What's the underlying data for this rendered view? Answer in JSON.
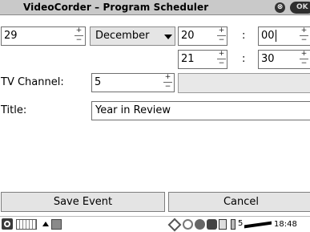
{
  "window": {
    "title": "VideoCorder – Program Scheduler",
    "close_glyph": "⊗",
    "ok_label": "OK"
  },
  "date": {
    "day": "29",
    "month": "December"
  },
  "start_time": {
    "hour": "20",
    "minute": "00"
  },
  "end_time": {
    "hour": "21",
    "minute": "30"
  },
  "time_separator": ":",
  "spinner": {
    "plus": "+",
    "minus": "−"
  },
  "tv_channel": {
    "label": "TV Channel:",
    "value": "5"
  },
  "title_field": {
    "label": "Title:",
    "value": "Year in Review"
  },
  "buttons": {
    "save": "Save Event",
    "cancel": "Cancel"
  },
  "taskbar": {
    "clock": "18:48",
    "signal_text": "5"
  },
  "icons": {
    "app": "app-icon",
    "keyboard": "keyboard-icon",
    "up_arrow": "up-arrow-icon",
    "tray": [
      "network-icon",
      "link-icon",
      "globe-icon",
      "media-icon",
      "clipboard-icon",
      "battery-icon"
    ]
  },
  "colors": {
    "titlebar": "#c9c9c9",
    "button_face": "#e4e4e4",
    "field_border": "#6f6f6f"
  }
}
